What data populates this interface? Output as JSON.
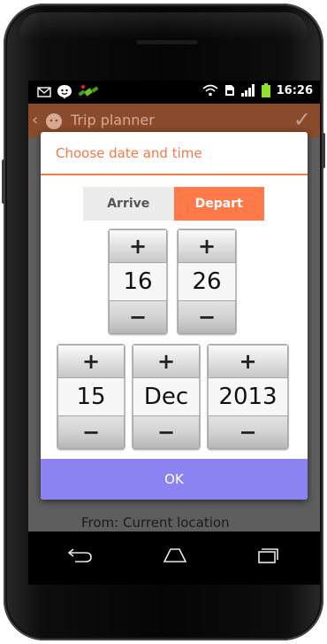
{
  "status_bar": {
    "time": "16:26",
    "notification_icons": [
      "mail-icon",
      "emoji-icon",
      "satellite-icon"
    ],
    "system_icons": [
      "wifi-icon",
      "sim-icon",
      "signal-icon",
      "battery-icon"
    ]
  },
  "action_bar": {
    "title": "Trip planner",
    "back_icon": "back-chevron-icon",
    "confirm_icon": "checkmark-icon"
  },
  "background": {
    "from_text": "From: Current location"
  },
  "dialog": {
    "title": "Choose date and time",
    "toggle": {
      "options": [
        "Arrive",
        "Depart"
      ],
      "selected": "Depart"
    },
    "time": {
      "hour": "16",
      "minute": "26"
    },
    "date": {
      "day": "15",
      "month": "Dec",
      "year": "2013"
    },
    "plus_label": "+",
    "minus_label": "−",
    "ok_label": "OK"
  },
  "nav_bar": {
    "icons": [
      "back-icon",
      "home-icon",
      "recents-icon"
    ]
  },
  "colors": {
    "accent": "#f5784a",
    "depart_bg": "#ff7a48",
    "ok_bg": "#8c83f3",
    "action_bar": "#8a4a2c"
  }
}
